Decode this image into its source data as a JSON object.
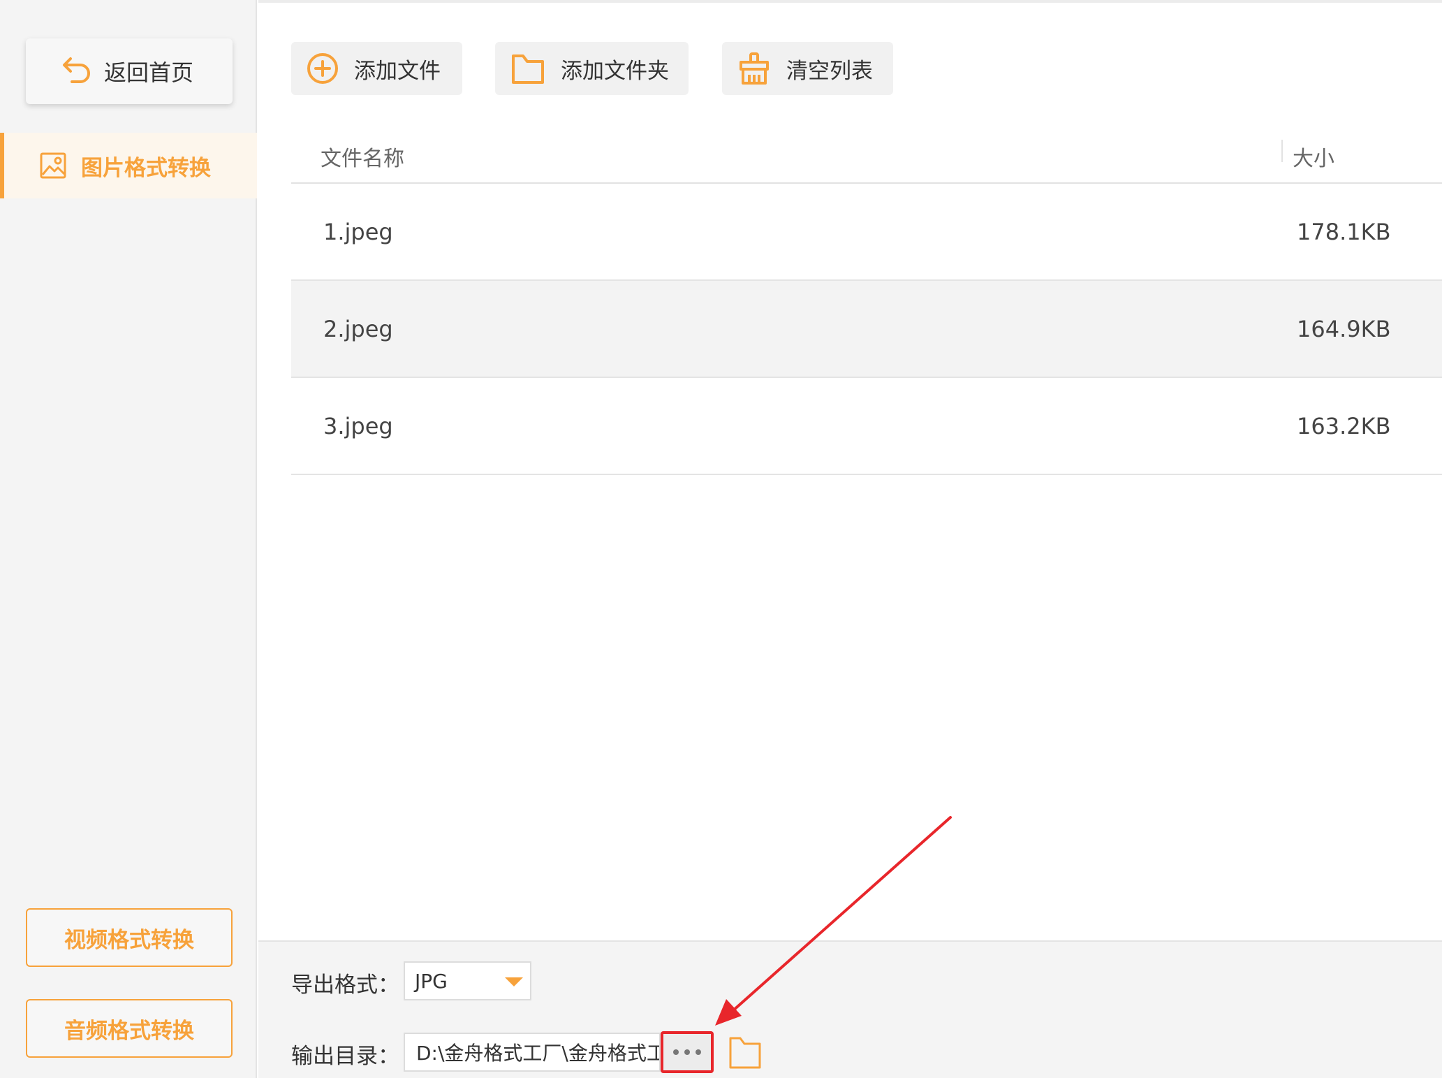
{
  "sidebar": {
    "back_label": "返回首页",
    "active_item_label": "图片格式转换",
    "video_button_label": "视频格式转换",
    "audio_button_label": "音频格式转换"
  },
  "toolbar": {
    "add_file_label": "添加文件",
    "add_folder_label": "添加文件夹",
    "clear_list_label": "清空列表"
  },
  "table": {
    "columns": [
      "文件名称",
      "大小"
    ],
    "rows": [
      {
        "name": "1.jpeg",
        "size": "178.1KB"
      },
      {
        "name": "2.jpeg",
        "size": "164.9KB"
      },
      {
        "name": "3.jpeg",
        "size": "163.2KB"
      }
    ]
  },
  "bottom": {
    "format_label": "导出格式：",
    "format_value": "JPG",
    "dir_label": "输出目录：",
    "dir_value": "D:\\金舟格式工厂\\金舟格式工"
  },
  "colors": {
    "accent": "#f7a23b",
    "highlight": "#e8262b"
  }
}
